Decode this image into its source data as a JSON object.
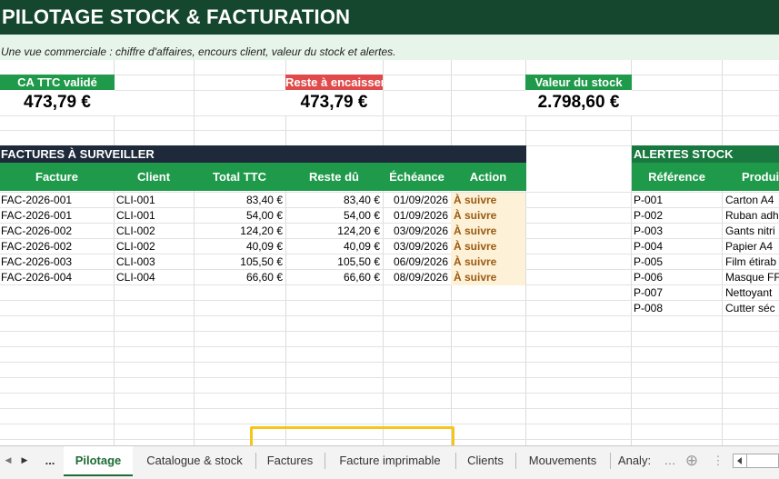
{
  "title": "PILOTAGE STOCK & FACTURATION",
  "subtitle": "Une vue commerciale : chiffre d'affaires, encours client, valeur du stock et alertes.",
  "kpis": {
    "ca": {
      "label": "CA TTC validé",
      "value": "473,79 €",
      "color": "#1f9a4a"
    },
    "reste": {
      "label": "Reste à encaisser",
      "value": "473,79 €",
      "color": "#e04a4a"
    },
    "stock": {
      "label": "Valeur du stock",
      "value": "2.798,60 €",
      "color": "#1f9a4a"
    }
  },
  "factures": {
    "section_title": "FACTURES À SURVEILLER",
    "headers": [
      "Facture",
      "Client",
      "Total TTC",
      "Reste dû",
      "Échéance",
      "Action"
    ],
    "rows": [
      [
        "FAC-2026-001",
        "CLI-001",
        "83,40 €",
        "83,40 €",
        "01/09/2026",
        "À suivre"
      ],
      [
        "FAC-2026-001",
        "CLI-001",
        "54,00 €",
        "54,00 €",
        "01/09/2026",
        "À suivre"
      ],
      [
        "FAC-2026-002",
        "CLI-002",
        "124,20 €",
        "124,20 €",
        "03/09/2026",
        "À suivre"
      ],
      [
        "FAC-2026-002",
        "CLI-002",
        "40,09 €",
        "40,09 €",
        "03/09/2026",
        "À suivre"
      ],
      [
        "FAC-2026-003",
        "CLI-003",
        "105,50 €",
        "105,50 €",
        "06/09/2026",
        "À suivre"
      ],
      [
        "FAC-2026-004",
        "CLI-004",
        "66,60 €",
        "66,60 €",
        "08/09/2026",
        "À suivre"
      ]
    ]
  },
  "alertes": {
    "section_title": "ALERTES STOCK",
    "headers": [
      "Référence",
      "Produi"
    ],
    "rows": [
      [
        "P-001",
        "Carton A4"
      ],
      [
        "P-002",
        "Ruban adh"
      ],
      [
        "P-003",
        "Gants nitri"
      ],
      [
        "P-004",
        "Papier A4"
      ],
      [
        "P-005",
        "Film étirab"
      ],
      [
        "P-006",
        "Masque FF"
      ],
      [
        "P-007",
        "Nettoyant"
      ],
      [
        "P-008",
        "Cutter séc"
      ]
    ]
  },
  "tabs": {
    "nav_prev": "◀",
    "nav_next": "▶",
    "more": "...",
    "items": [
      "Pilotage",
      "Catalogue & stock",
      "Factures",
      "Facture imprimable",
      "Clients",
      "Mouvements",
      "Analy:"
    ],
    "active": "Pilotage",
    "add_icon": "⊕",
    "menu_icon": "⋮"
  },
  "colors": {
    "title_bg": "#15472e",
    "header_green": "#1f9a4a",
    "section_dark": "#1e2a3a",
    "action_text": "#9c5a12",
    "highlight_box": "#f5c518"
  }
}
